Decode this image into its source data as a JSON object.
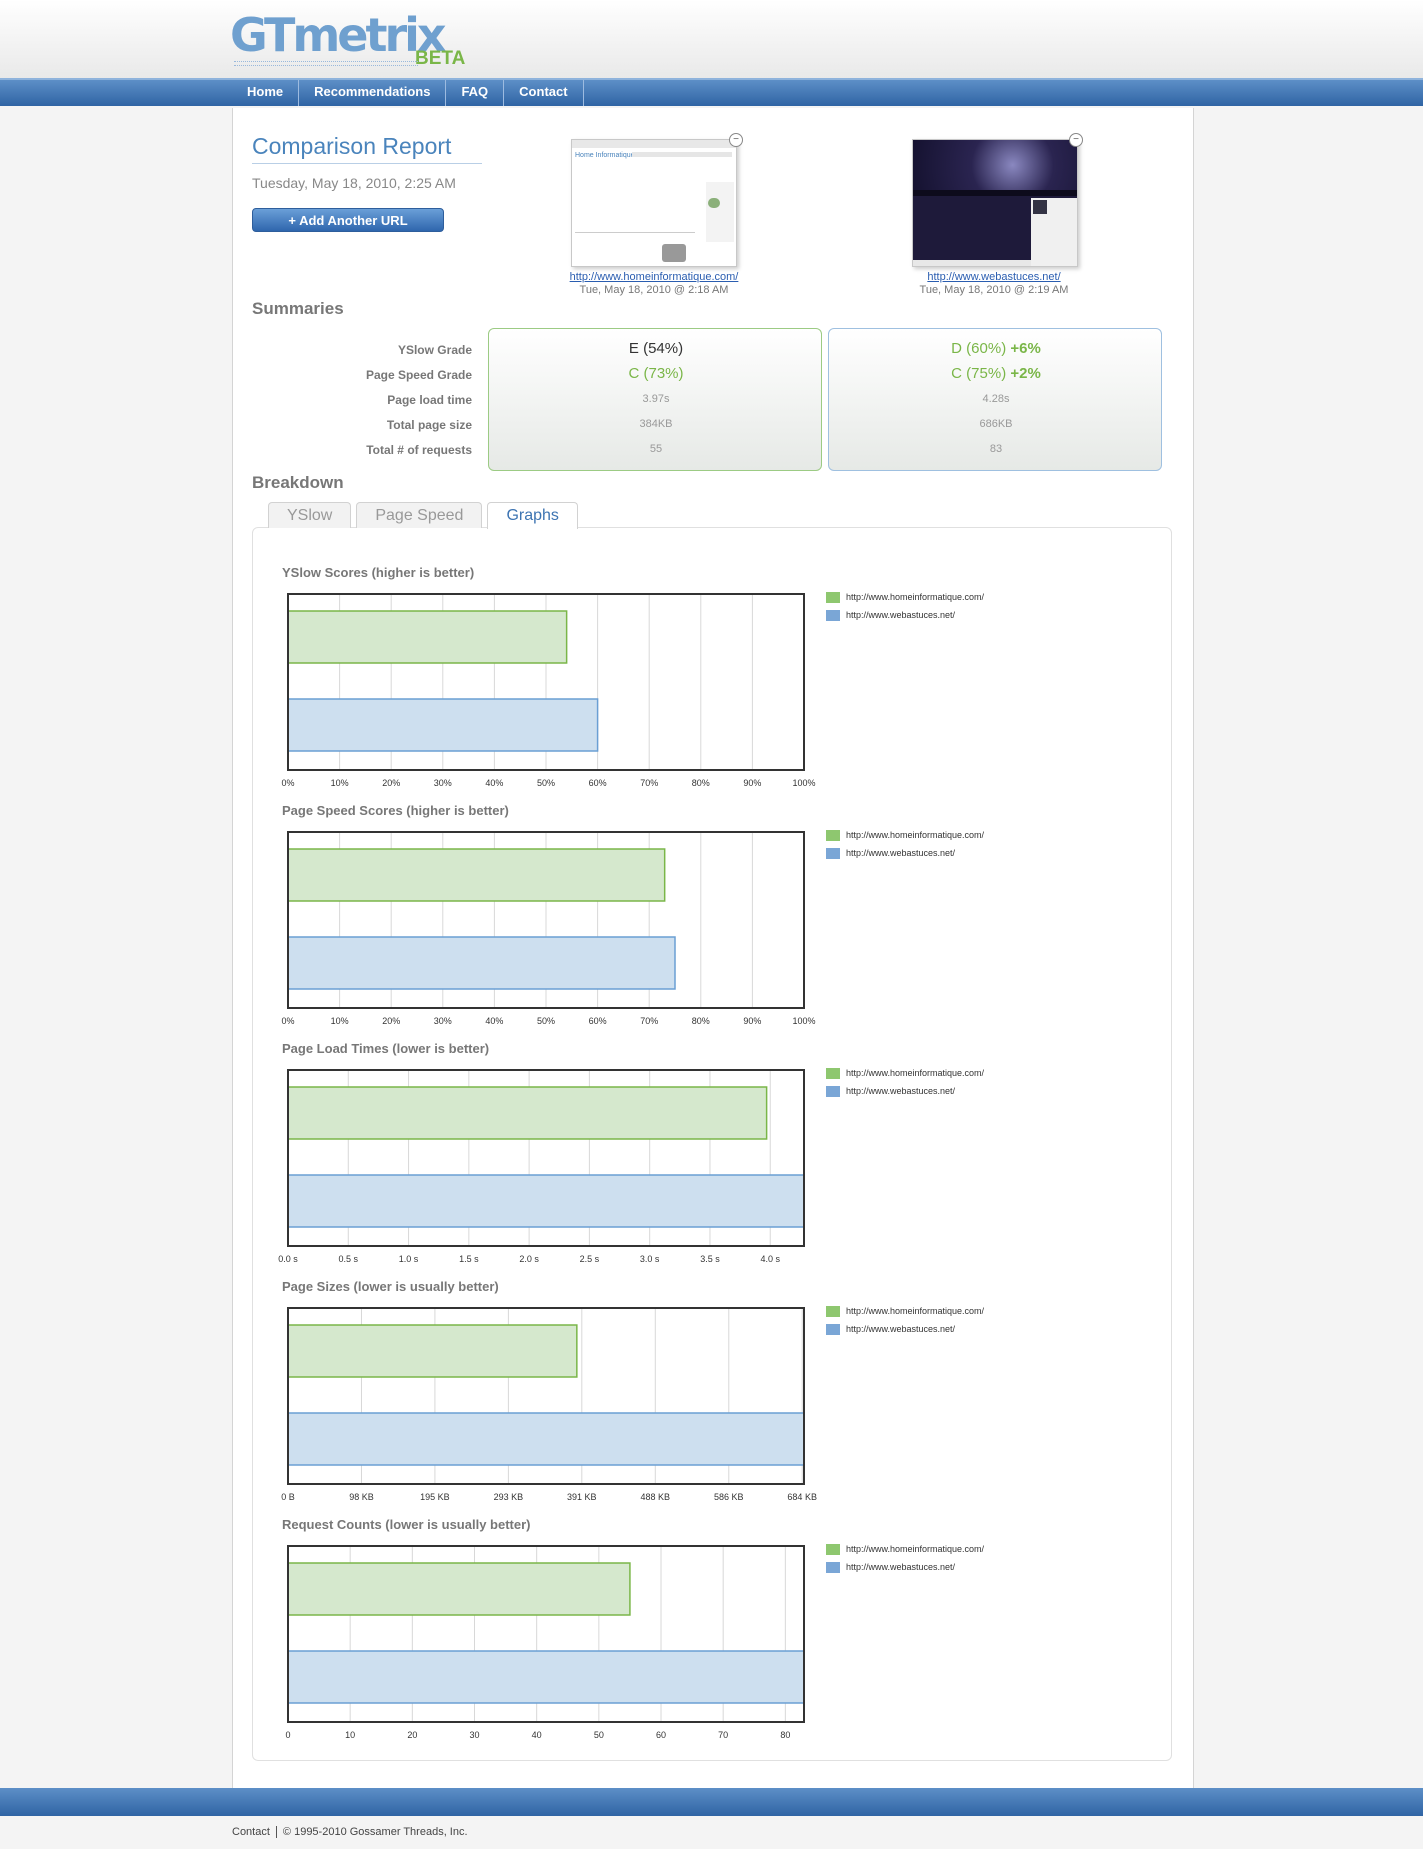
{
  "brand": {
    "logo": "GTmetrix",
    "beta": "BETA"
  },
  "nav": [
    "Home",
    "Recommendations",
    "FAQ",
    "Contact"
  ],
  "report": {
    "title": "Comparison Report",
    "date": "Tuesday, May 18, 2010, 2:25 AM",
    "add_url_label": "+ Add Another URL"
  },
  "sites": [
    {
      "url": "http://www.homeinformatique.com/",
      "date": "Tue, May 18, 2010 @ 2:18 AM",
      "thumb_heading": "Home Informatique"
    },
    {
      "url": "http://www.webastuces.net/",
      "date": "Tue, May 18, 2010 @ 2:19 AM",
      "thumb_heading": ""
    }
  ],
  "summaries": {
    "heading": "Summaries",
    "labels": [
      "YSlow Grade",
      "Page Speed Grade",
      "Page load time",
      "Total page size",
      "Total # of requests"
    ],
    "site1": {
      "yslow": "E (54%)",
      "pagespeed": "C (73%)",
      "load": "3.97s",
      "size": "384KB",
      "requests": "55"
    },
    "site2": {
      "yslow": "D (60%)",
      "yslow_diff": "+6%",
      "pagespeed": "C (75%)",
      "pagespeed_diff": "+2%",
      "load": "4.28s",
      "size": "686KB",
      "requests": "83"
    }
  },
  "breakdown": {
    "heading": "Breakdown",
    "tabs": [
      "YSlow",
      "Page Speed",
      "Graphs"
    ],
    "active_tab": "Graphs"
  },
  "colors": {
    "green": "#7ab648",
    "blue": "#4a84bc",
    "green_fill": "#d5e8cd",
    "blue_fill": "#cddfef"
  },
  "legend": [
    "http://www.homeinformatique.com/",
    "http://www.webastuces.net/"
  ],
  "chart_data": [
    {
      "type": "bar",
      "title": "YSlow Scores (higher is better)",
      "series": [
        {
          "name": "http://www.homeinformatique.com/",
          "values": [
            54
          ]
        },
        {
          "name": "http://www.webastuces.net/",
          "values": [
            60
          ]
        }
      ],
      "xlim": [
        0,
        100
      ],
      "ticks": [
        "0%",
        "10%",
        "20%",
        "30%",
        "40%",
        "50%",
        "60%",
        "70%",
        "80%",
        "90%",
        "100%"
      ],
      "tick_values": [
        0,
        10,
        20,
        30,
        40,
        50,
        60,
        70,
        80,
        90,
        100
      ],
      "grid": true
    },
    {
      "type": "bar",
      "title": "Page Speed Scores (higher is better)",
      "series": [
        {
          "name": "http://www.homeinformatique.com/",
          "values": [
            73
          ]
        },
        {
          "name": "http://www.webastuces.net/",
          "values": [
            75
          ]
        }
      ],
      "xlim": [
        0,
        100
      ],
      "ticks": [
        "0%",
        "10%",
        "20%",
        "30%",
        "40%",
        "50%",
        "60%",
        "70%",
        "80%",
        "90%",
        "100%"
      ],
      "tick_values": [
        0,
        10,
        20,
        30,
        40,
        50,
        60,
        70,
        80,
        90,
        100
      ],
      "grid": true
    },
    {
      "type": "bar",
      "title": "Page Load Times (lower is better)",
      "series": [
        {
          "name": "http://www.homeinformatique.com/",
          "values": [
            3.97
          ]
        },
        {
          "name": "http://www.webastuces.net/",
          "values": [
            4.28
          ]
        }
      ],
      "xlim": [
        0,
        4.28
      ],
      "ticks": [
        "0.0 s",
        "0.5 s",
        "1.0 s",
        "1.5 s",
        "2.0 s",
        "2.5 s",
        "3.0 s",
        "3.5 s",
        "4.0 s"
      ],
      "tick_values": [
        0,
        0.5,
        1.0,
        1.5,
        2.0,
        2.5,
        3.0,
        3.5,
        4.0
      ],
      "grid": true
    },
    {
      "type": "bar",
      "title": "Page Sizes (lower is usually better)",
      "series": [
        {
          "name": "http://www.homeinformatique.com/",
          "values": [
            384
          ]
        },
        {
          "name": "http://www.webastuces.net/",
          "values": [
            686
          ]
        }
      ],
      "xlim": [
        0,
        686
      ],
      "ticks": [
        "0 B",
        "98 KB",
        "195 KB",
        "293 KB",
        "391 KB",
        "488 KB",
        "586 KB",
        "684 KB"
      ],
      "tick_values": [
        0,
        97.7,
        195.3,
        293,
        390.6,
        488.3,
        586,
        683.6
      ],
      "grid": true
    },
    {
      "type": "bar",
      "title": "Request Counts (lower is usually better)",
      "series": [
        {
          "name": "http://www.homeinformatique.com/",
          "values": [
            55
          ]
        },
        {
          "name": "http://www.webastuces.net/",
          "values": [
            83
          ]
        }
      ],
      "xlim": [
        0,
        83
      ],
      "ticks": [
        "0",
        "10",
        "20",
        "30",
        "40",
        "50",
        "60",
        "70",
        "80"
      ],
      "tick_values": [
        0,
        10,
        20,
        30,
        40,
        50,
        60,
        70,
        80
      ],
      "grid": true
    }
  ],
  "footer": {
    "contact": "Contact",
    "copyright": "© 1995-2010 Gossamer Threads, Inc."
  }
}
